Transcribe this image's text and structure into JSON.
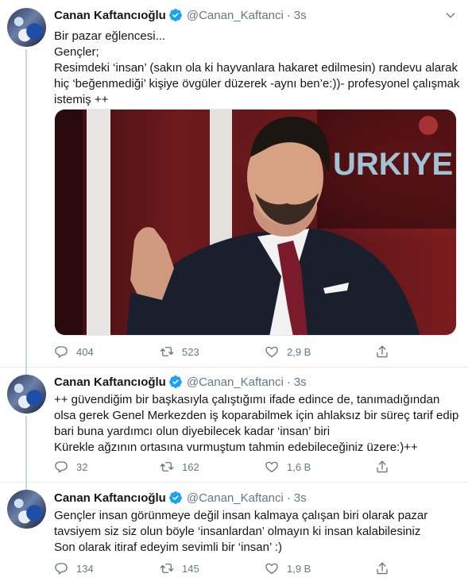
{
  "author": {
    "name": "Canan Kaftancıoğlu",
    "handle": "@Canan_Kaftanci",
    "time": "3s"
  },
  "icons": {
    "verified": "verified-badge-icon",
    "reply": "reply-icon",
    "retweet": "retweet-icon",
    "like": "like-icon",
    "share": "share-icon",
    "more": "chevron-down-icon"
  },
  "colors": {
    "accent": "#1da1f2",
    "muted": "#657786",
    "text": "#14171a"
  },
  "media": {
    "overlay_text": "URKIYE"
  },
  "tweets": [
    {
      "lines": [
        "Bir pazar eğlencesi...",
        "Gençler;",
        "Resimdeki ‘insan’ (sakın ola ki hayvanlara hakaret edilmesin) randevu alarak",
        "hiç ‘beğenmediği’ kişiye övgüler düzerek -aynı ben’e:))- profesyonel çalışmak",
        "istemiş ++"
      ],
      "replies": "404",
      "retweets": "523",
      "likes": "2,9 B"
    },
    {
      "lines": [
        "++ güvendiğim bir başkasıyla çalıştığımı ifade edince de, tanımadığından",
        "olsa gerek Genel Merkezden iş koparabilmek için  ahlaksız bir süreç tarif edip",
        "bari buna yardımcı olun diyebilecek kadar ‘insan’ biri",
        "Kürekle ağzının ortasına vurmuştum tahmin edebileceğiniz üzere:)++"
      ],
      "replies": "32",
      "retweets": "162",
      "likes": "1,6 B"
    },
    {
      "lines": [
        "Gençler insan görünmeye değil insan kalmaya çalışan biri olarak pazar",
        "tavsiyem siz siz olun böyle ‘insanlardan’ olmayın ki insan kalabilesiniz",
        "Son olarak itiraf edeyim sevimli bir ‘insan’ :)"
      ],
      "replies": "134",
      "retweets": "145",
      "likes": "1,9 B"
    }
  ]
}
